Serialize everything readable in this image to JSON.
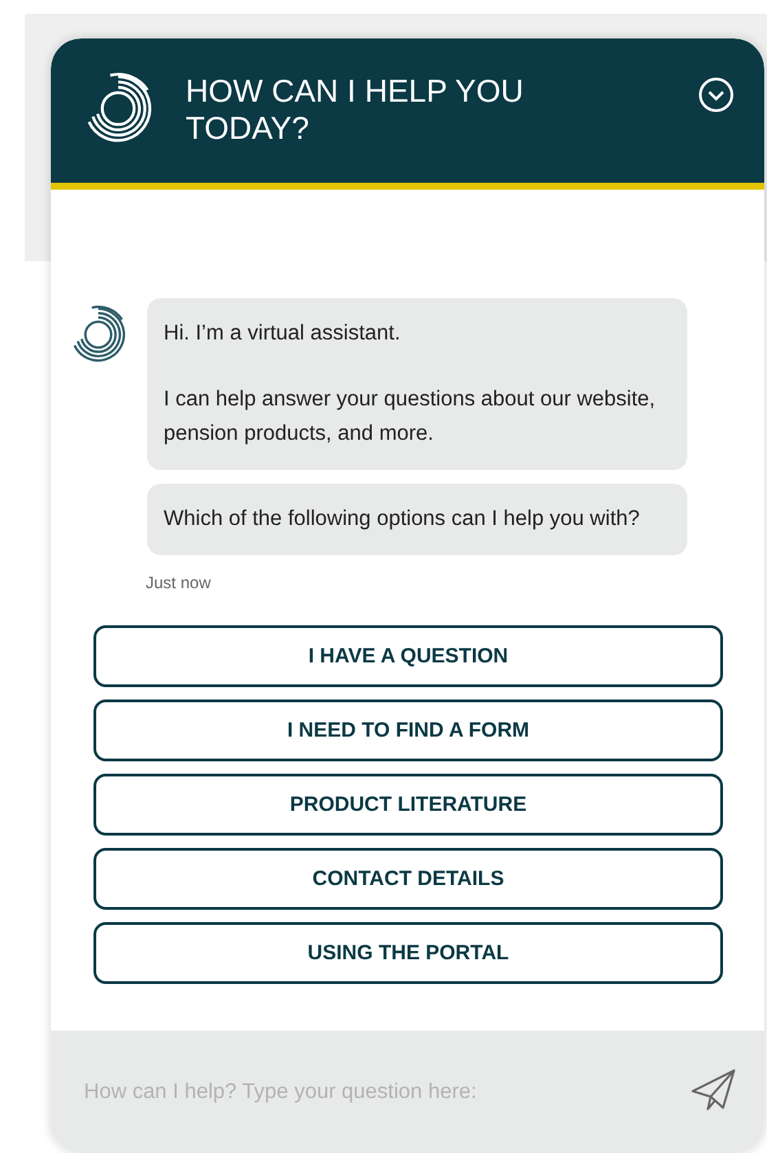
{
  "header": {
    "title": "HOW CAN I HELP YOU TODAY?",
    "expanded": true
  },
  "messages": [
    {
      "paragraphs": [
        "Hi. I’m a virtual assistant.",
        "I can help answer your questions about our website, pension products, and more."
      ]
    },
    {
      "paragraphs": [
        "Which of the following options can I help you with?"
      ]
    }
  ],
  "timestamp": "Just now",
  "options": [
    "I HAVE A QUESTION",
    "I NEED TO FIND A FORM",
    "PRODUCT LITERATURE",
    "CONTACT DETAILS",
    "USING THE PORTAL"
  ],
  "composer": {
    "placeholder": "How can I help? Type your question here:"
  }
}
